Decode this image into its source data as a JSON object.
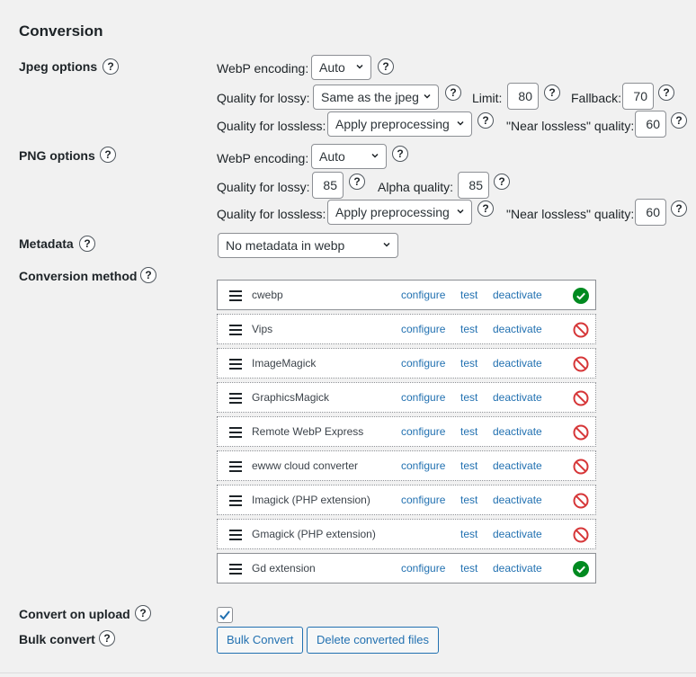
{
  "section_title": "Conversion",
  "help_glyph": "?",
  "jpeg": {
    "label": "Jpeg options",
    "webp_encoding_label": "WebP encoding:",
    "webp_encoding_value": "Auto",
    "quality_lossy_label": "Quality for lossy:",
    "quality_lossy_value": "Same as the jpeg",
    "limit_label": "Limit:",
    "limit_value": "80",
    "fallback_label": "Fallback:",
    "fallback_value": "70",
    "quality_lossless_label": "Quality for lossless:",
    "quality_lossless_value": "Apply preprocessing",
    "near_lossless_label": "\"Near lossless\" quality:",
    "near_lossless_value": "60"
  },
  "png": {
    "label": "PNG options",
    "webp_encoding_label": "WebP encoding:",
    "webp_encoding_value": "Auto",
    "quality_lossy_label": "Quality for lossy:",
    "quality_lossy_value": "85",
    "alpha_quality_label": "Alpha quality:",
    "alpha_quality_value": "85",
    "quality_lossless_label": "Quality for lossless:",
    "quality_lossless_value": "Apply preprocessing",
    "near_lossless_label": "\"Near lossless\" quality:",
    "near_lossless_value": "60"
  },
  "metadata": {
    "label": "Metadata",
    "value": "No metadata in webp"
  },
  "conversion_method": {
    "label": "Conversion method",
    "link_configure": "configure",
    "link_test": "test",
    "link_deactivate": "deactivate",
    "converters": [
      {
        "name": "cwebp",
        "configure": true,
        "status": "ok"
      },
      {
        "name": "Vips",
        "configure": true,
        "status": "unavailable"
      },
      {
        "name": "ImageMagick",
        "configure": true,
        "status": "unavailable"
      },
      {
        "name": "GraphicsMagick",
        "configure": true,
        "status": "unavailable"
      },
      {
        "name": "Remote WebP Express",
        "configure": true,
        "status": "unavailable"
      },
      {
        "name": "ewww cloud converter",
        "configure": true,
        "status": "unavailable"
      },
      {
        "name": "Imagick (PHP extension)",
        "configure": true,
        "status": "unavailable"
      },
      {
        "name": "Gmagick (PHP extension)",
        "configure": false,
        "status": "unavailable"
      },
      {
        "name": "Gd extension",
        "configure": true,
        "status": "ok"
      }
    ]
  },
  "convert_on_upload": {
    "label": "Convert on upload",
    "checked": true
  },
  "bulk_convert": {
    "label": "Bulk convert",
    "bulk_button": "Bulk Convert",
    "delete_button": "Delete converted files"
  },
  "colors": {
    "link": "#2271b1",
    "ok": "#008a20",
    "error": "#d63638"
  }
}
